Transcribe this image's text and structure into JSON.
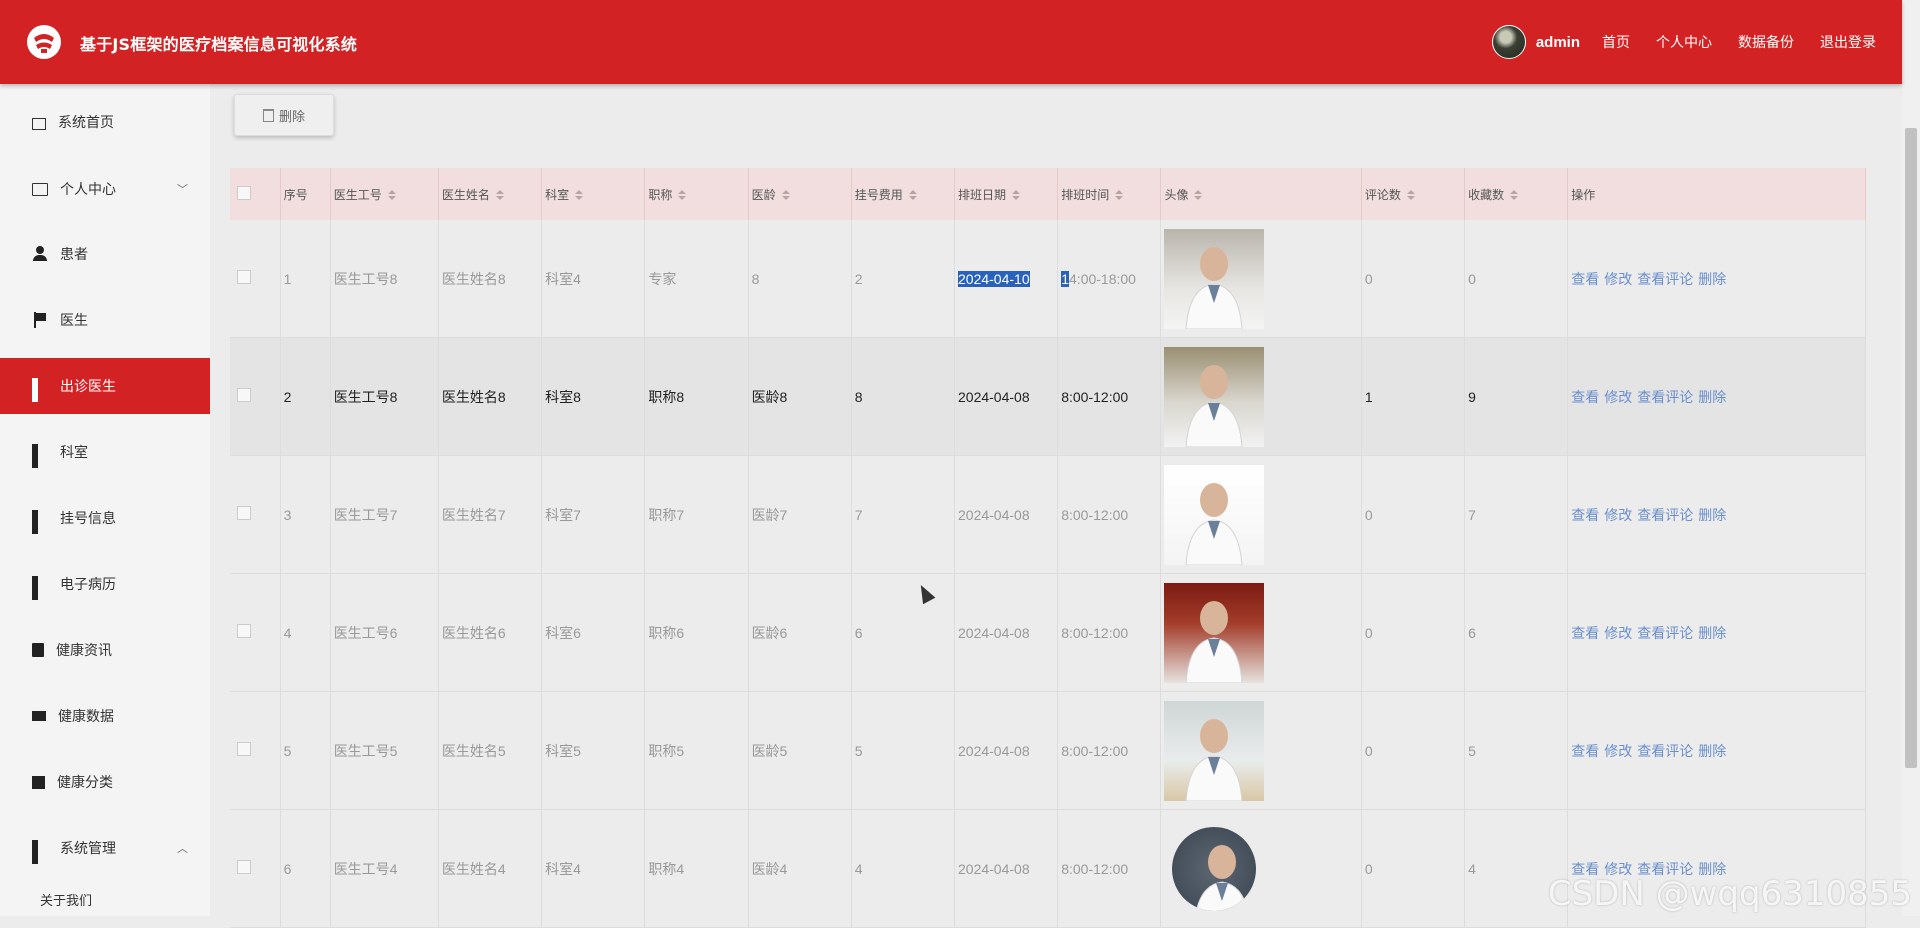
{
  "header": {
    "title": "基于JS框架的医疗档案信息可视化系统",
    "username": "admin",
    "links": [
      "首页",
      "个人中心",
      "数据备份",
      "退出登录"
    ]
  },
  "sidebar": {
    "items": [
      {
        "label": "系统首页",
        "icon": "home-icon"
      },
      {
        "label": "个人中心",
        "icon": "card-icon"
      },
      {
        "label": "患者",
        "icon": "person-icon"
      },
      {
        "label": "医生",
        "icon": "flag-icon"
      },
      {
        "label": "出诊医生",
        "icon": "grid-icon"
      },
      {
        "label": "科室",
        "icon": "grid-icon"
      },
      {
        "label": "挂号信息",
        "icon": "grid-icon"
      },
      {
        "label": "电子病历",
        "icon": "grid-icon"
      },
      {
        "label": "健康资讯",
        "icon": "clipboard-icon"
      },
      {
        "label": "健康数据",
        "icon": "monitor-icon"
      },
      {
        "label": "健康分类",
        "icon": "book-icon"
      },
      {
        "label": "系统管理",
        "icon": "grid-icon"
      }
    ],
    "sub_item": "关于我们",
    "active_index": 4
  },
  "toolbar": {
    "delete_label": "删除"
  },
  "table": {
    "columns": [
      "序号",
      "医生工号",
      "医生姓名",
      "科室",
      "职称",
      "医龄",
      "挂号费用",
      "排班日期",
      "排班时间",
      "头像",
      "评论数",
      "收藏数",
      "操作"
    ],
    "actions": [
      "查看",
      "修改",
      "查看评论",
      "删除"
    ],
    "rows": [
      {
        "no": "1",
        "doc_id": "医生工号8",
        "name": "医生姓名8",
        "dept": "科室4",
        "title": "专家",
        "years": "8",
        "fee": "2",
        "date": "2024-04-10",
        "time_first": "1",
        "time_rest": "4:00-18:00",
        "comments": "0",
        "favorites": "0"
      },
      {
        "no": "2",
        "doc_id": "医生工号8",
        "name": "医生姓名8",
        "dept": "科室8",
        "title": "职称8",
        "years": "医龄8",
        "fee": "8",
        "date": "2024-04-08",
        "time_first": "",
        "time_rest": "8:00-12:00",
        "comments": "1",
        "favorites": "9"
      },
      {
        "no": "3",
        "doc_id": "医生工号7",
        "name": "医生姓名7",
        "dept": "科室7",
        "title": "职称7",
        "years": "医龄7",
        "fee": "7",
        "date": "2024-04-08",
        "time_first": "",
        "time_rest": "8:00-12:00",
        "comments": "0",
        "favorites": "7"
      },
      {
        "no": "4",
        "doc_id": "医生工号6",
        "name": "医生姓名6",
        "dept": "科室6",
        "title": "职称6",
        "years": "医龄6",
        "fee": "6",
        "date": "2024-04-08",
        "time_first": "",
        "time_rest": "8:00-12:00",
        "comments": "0",
        "favorites": "6"
      },
      {
        "no": "5",
        "doc_id": "医生工号5",
        "name": "医生姓名5",
        "dept": "科室5",
        "title": "职称5",
        "years": "医龄5",
        "fee": "5",
        "date": "2024-04-08",
        "time_first": "",
        "time_rest": "8:00-12:00",
        "comments": "0",
        "favorites": "5"
      },
      {
        "no": "6",
        "doc_id": "医生工号4",
        "name": "医生姓名4",
        "dept": "科室4",
        "title": "职称4",
        "years": "医龄4",
        "fee": "4",
        "date": "2024-04-08",
        "time_first": "",
        "time_rest": "8:00-12:00",
        "comments": "0",
        "favorites": "4"
      }
    ]
  },
  "watermark": "CSDN @wqq6310855",
  "colors": {
    "header_bg": "#d22223",
    "active_nav": "#d22223",
    "action_link": "#6a8fcf",
    "table_header": "#f2dede"
  }
}
